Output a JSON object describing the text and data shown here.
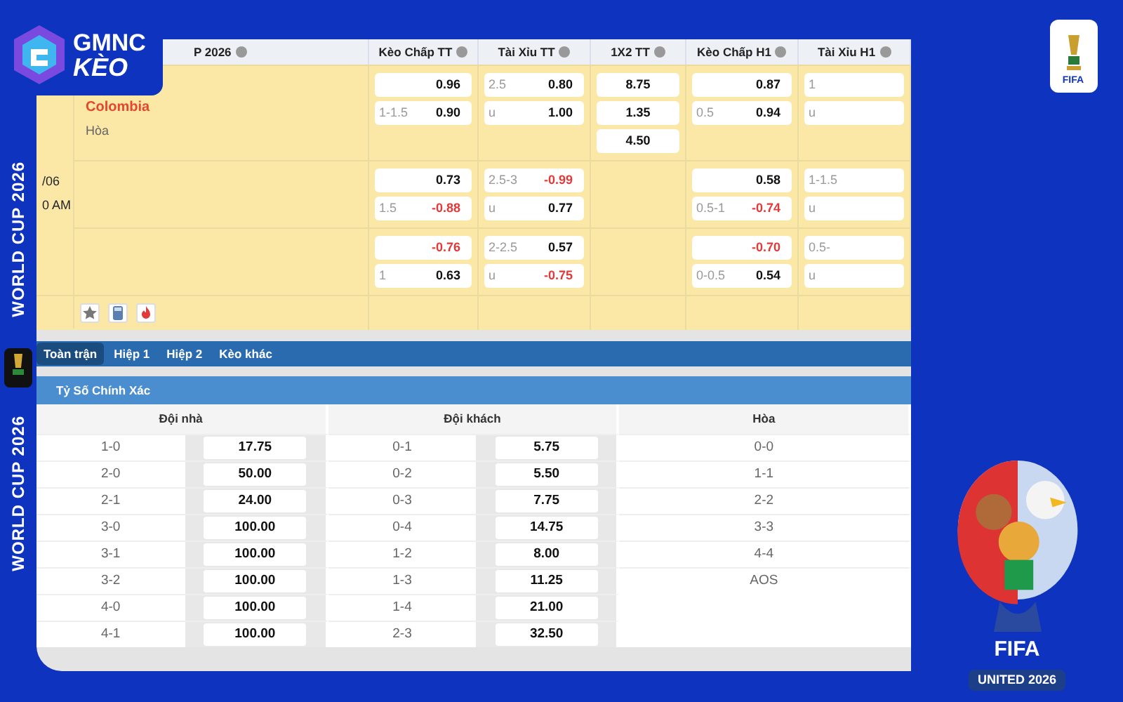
{
  "logo": {
    "line_1": "GMNC",
    "line_2": "KÈO"
  },
  "side_banner": [
    "WORLD CUP 2026",
    "WORLD CUP 2026"
  ],
  "match_table": {
    "title": "P 2026",
    "columns": [
      "Kèo Chấp TT",
      "Tài Xỉu TT",
      "1X2 TT",
      "Kèo Chấp H1",
      "Tài Xỉu H1"
    ],
    "date": "/06",
    "time": "0 AM",
    "teams": [
      {
        "name": "Colombia",
        "favorite": true
      },
      {
        "name": "Hòa",
        "favorite": false
      }
    ],
    "rows": [
      {
        "cells": [
          [
            {
              "odds": "0.96",
              "negative": false
            },
            {
              "line": "1-1.5",
              "odds": "0.90",
              "negative": false
            }
          ],
          [
            {
              "line": "2.5",
              "odds": "0.80",
              "negative": false
            },
            {
              "line": "u",
              "odds": "1.00",
              "negative": false
            }
          ],
          [
            {
              "odds": "8.75",
              "negative": false
            },
            {
              "odds": "1.35",
              "negative": false
            },
            {
              "odds": "4.50",
              "negative": false
            }
          ],
          [
            {
              "odds": "0.87",
              "negative": false
            },
            {
              "line": "0.5",
              "odds": "0.94",
              "negative": false
            }
          ],
          [
            {
              "line": "1"
            },
            {
              "line": "u"
            }
          ]
        ]
      },
      {
        "cells": [
          [
            {
              "odds": "0.73",
              "negative": false
            },
            {
              "line": "1.5",
              "odds": "-0.88",
              "negative": true
            }
          ],
          [
            {
              "line": "2.5-3",
              "odds": "-0.99",
              "negative": true
            },
            {
              "line": "u",
              "odds": "0.77",
              "negative": false
            }
          ],
          [],
          [
            {
              "odds": "0.58",
              "negative": false
            },
            {
              "line": "0.5-1",
              "odds": "-0.74",
              "negative": true
            }
          ],
          [
            {
              "line": "1-1.5"
            },
            {
              "line": "u"
            }
          ]
        ]
      },
      {
        "cells": [
          [
            {
              "odds": "-0.76",
              "negative": true
            },
            {
              "line": "1",
              "odds": "0.63",
              "negative": false
            }
          ],
          [
            {
              "line": "2-2.5",
              "odds": "0.57",
              "negative": false
            },
            {
              "line": "u",
              "odds": "-0.75",
              "negative": true
            }
          ],
          [],
          [
            {
              "odds": "-0.70",
              "negative": true
            },
            {
              "line": "0-0.5",
              "odds": "0.54",
              "negative": false
            }
          ],
          [
            {
              "line": "0.5-"
            },
            {
              "line": "u"
            }
          ]
        ]
      }
    ]
  },
  "tabs": [
    {
      "label": "Toàn trận",
      "selected": true
    },
    {
      "label": "Hiệp 1",
      "selected": false
    },
    {
      "label": "Hiệp 2",
      "selected": false
    },
    {
      "label": "Kèo khác",
      "selected": false
    }
  ],
  "section_title": "Tỷ Số Chính Xác",
  "correct_score": [
    {
      "heading": "Đội nhà",
      "rows": [
        {
          "score": "1-0",
          "odds": "17.75"
        },
        {
          "score": "2-0",
          "odds": "50.00"
        },
        {
          "score": "2-1",
          "odds": "24.00"
        },
        {
          "score": "3-0",
          "odds": "100.00"
        },
        {
          "score": "3-1",
          "odds": "100.00"
        },
        {
          "score": "3-2",
          "odds": "100.00"
        },
        {
          "score": "4-0",
          "odds": "100.00"
        },
        {
          "score": "4-1",
          "odds": "100.00"
        }
      ]
    },
    {
      "heading": "Đội khách",
      "rows": [
        {
          "score": "0-1",
          "odds": "5.75"
        },
        {
          "score": "0-2",
          "odds": "5.50"
        },
        {
          "score": "0-3",
          "odds": "7.75"
        },
        {
          "score": "0-4",
          "odds": "14.75"
        },
        {
          "score": "1-2",
          "odds": "8.00"
        },
        {
          "score": "1-3",
          "odds": "11.25"
        },
        {
          "score": "1-4",
          "odds": "21.00"
        },
        {
          "score": "2-3",
          "odds": "32.50"
        }
      ]
    },
    {
      "heading": "Hòa",
      "rows": [
        {
          "score": "0-0"
        },
        {
          "score": "1-1"
        },
        {
          "score": "2-2"
        },
        {
          "score": "3-3"
        },
        {
          "score": "4-4"
        },
        {
          "score": "AOS"
        }
      ]
    }
  ],
  "fifa_logo": {
    "label": "FIFA"
  },
  "mascot_badge": {
    "line_1": "FIFA",
    "line_2": "UNITED 2026"
  }
}
